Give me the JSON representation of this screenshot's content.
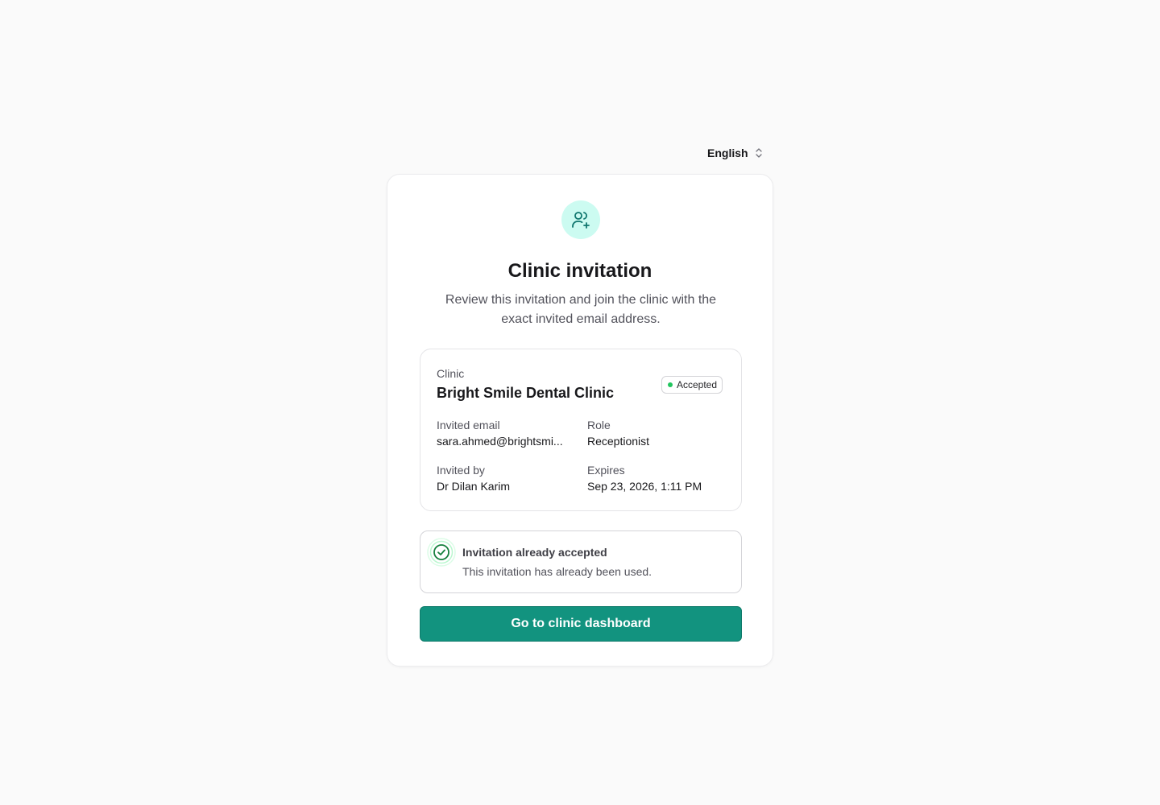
{
  "language": {
    "selected": "English"
  },
  "invitation": {
    "title": "Clinic invitation",
    "subtitle": "Review this invitation and join the clinic with the exact invited email address.",
    "clinic_label": "Clinic",
    "clinic_name": "Bright Smile Dental Clinic",
    "status_badge": "Accepted",
    "invited_email_label": "Invited email",
    "invited_email": "sara.ahmed@brightsmi...",
    "role_label": "Role",
    "role": "Receptionist",
    "invited_by_label": "Invited by",
    "invited_by": "Dr Dilan Karim",
    "expires_label": "Expires",
    "expires": "Sep 23, 2026, 1:11 PM"
  },
  "status": {
    "title": "Invitation already accepted",
    "description": "This invitation has already been used."
  },
  "actions": {
    "primary_label": "Go to clinic dashboard"
  },
  "icons": {
    "hero": "user-plus-icon",
    "status": "check-circle-icon",
    "language": "chevron-up-down-icon"
  },
  "colors": {
    "accent": "#12937f",
    "accent_light": "#ccfbf1",
    "success": "#22c55e"
  }
}
